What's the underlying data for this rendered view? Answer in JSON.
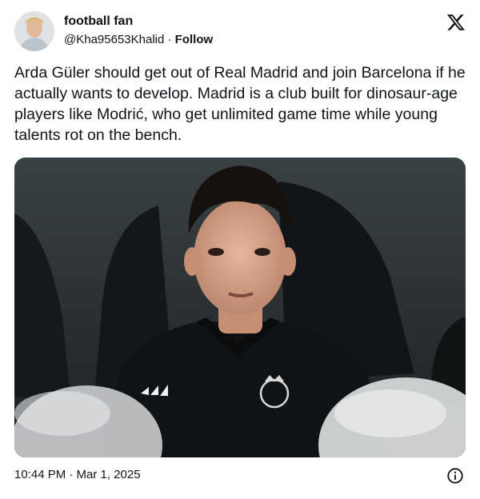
{
  "author": {
    "display_name": "football fan",
    "handle": "@Kha95653Khalid",
    "separator": "·",
    "follow_label": "Follow"
  },
  "tweet": {
    "text": "Arda Güler should get out of Real Madrid and join Barcelona if he actually wants to develop. Madrid is a club built for dinosaur-age players like Modrić, who get unlimited game time while young talents rot on the bench."
  },
  "media": {
    "description_icon": "photo"
  },
  "footer": {
    "timestamp": "10:44 PM · Mar 1, 2025"
  },
  "icons": {
    "brand": "x-logo-icon",
    "info": "info-icon"
  },
  "colors": {
    "text": "#0f1419",
    "background": "#ffffff"
  }
}
